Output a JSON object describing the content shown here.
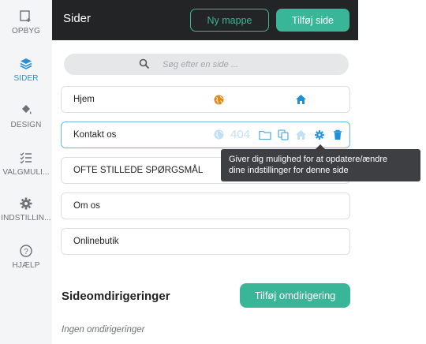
{
  "rail": [
    {
      "label": "OPBYG",
      "icon": "build-icon"
    },
    {
      "label": "SIDER",
      "icon": "layers-icon"
    },
    {
      "label": "DESIGN",
      "icon": "paint-bucket-icon"
    },
    {
      "label": "VALGMULI...",
      "icon": "checklist-icon"
    },
    {
      "label": "INDSTILLIN...",
      "icon": "gear-icon"
    },
    {
      "label": "HJÆLP",
      "icon": "help-icon"
    }
  ],
  "header": {
    "title": "Sider",
    "new_folder": "Ny mappe",
    "add_page": "Tilføj side"
  },
  "search": {
    "placeholder": "Søg efter en side ..."
  },
  "pages": [
    {
      "name": "Hjem"
    },
    {
      "name": "Kontakt os",
      "badge_404": "404"
    },
    {
      "name": "OFTE STILLEDE SPØRGSMÅL"
    },
    {
      "name": "Om os"
    },
    {
      "name": "Onlinebutik"
    }
  ],
  "tooltip": {
    "line1": "Giver dig mulighed for at opdatere/ændre",
    "line2": "dine indstillinger for denne side"
  },
  "redirects": {
    "title": "Sideomdirigeringer",
    "add_button": "Tilføj omdirigering",
    "empty": "Ingen omdirigeringer"
  },
  "colors": {
    "accent": "#39b697",
    "active_blue": "#2a8fd6",
    "topbar": "#232425",
    "home_blue": "#1e8fd8",
    "globe_orange": "#e08a1e"
  }
}
